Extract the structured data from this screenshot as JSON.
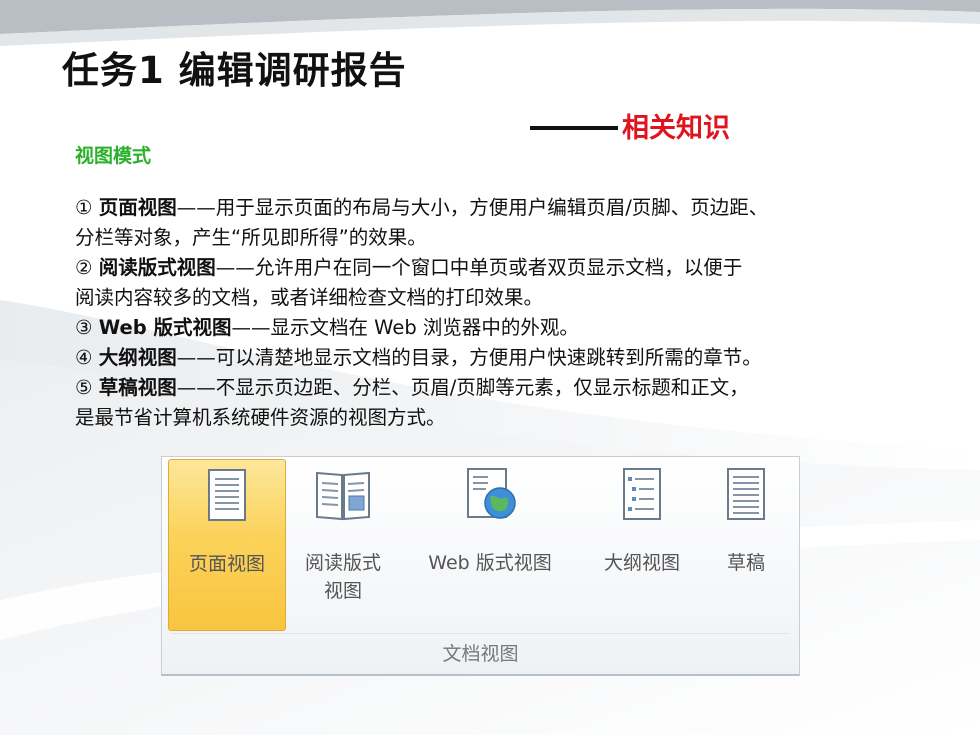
{
  "title": "任务1 编辑调研报告",
  "subtitle": "相关知识",
  "section_heading": "视图模式",
  "items": [
    {
      "marker": "①",
      "term": "页面视图",
      "line1": "——用于显示页面的布局与大小，方便用户编辑页眉/页脚、页边距、",
      "line2": "分栏等对象，产生“所见即所得”的效果。"
    },
    {
      "marker": "②",
      "term": "阅读版式视图",
      "line1": "——允许用户在同一个窗口中单页或者双页显示文档，以便于",
      "line2": "阅读内容较多的文档，或者详细检查文档的打印效果。"
    },
    {
      "marker": "③",
      "term": "Web 版式视图",
      "line1": "——显示文档在 Web 浏览器中的外观。",
      "line2": ""
    },
    {
      "marker": "④",
      "term": "大纲视图",
      "line1": "——可以清楚地显示文档的目录，方便用户快速跳转到所需的章节。",
      "line2": ""
    },
    {
      "marker": "⑤",
      "term": "草稿视图",
      "line1": "——不显示页边距、分栏、页眉/页脚等元素，仅显示标题和正文，",
      "line2": "是最节省计算机系统硬件资源的视图方式。"
    }
  ],
  "ribbon": {
    "group_label": "文档视图",
    "buttons": [
      {
        "label": "页面视图",
        "label2": "",
        "icon": "page-layout-icon",
        "active": true
      },
      {
        "label": "阅读版式",
        "label2": "视图",
        "icon": "reading-layout-icon",
        "active": false
      },
      {
        "label": "Web 版式视图",
        "label2": "",
        "icon": "web-layout-icon",
        "active": false
      },
      {
        "label": "大纲视图",
        "label2": "",
        "icon": "outline-icon",
        "active": false
      },
      {
        "label": "草稿",
        "label2": "",
        "icon": "draft-icon",
        "active": false
      }
    ]
  },
  "colors": {
    "title": "#111111",
    "subtitle": "#e0141e",
    "section": "#2bb02b",
    "active_button": "#fbd25a"
  }
}
